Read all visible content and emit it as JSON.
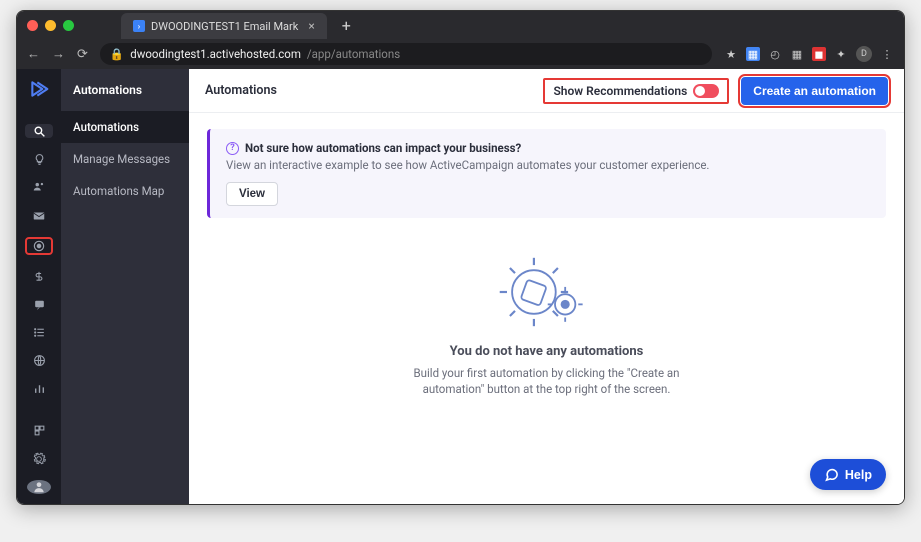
{
  "browser": {
    "tab_title": "DWOODINGTEST1 Email Mark",
    "url_domain": "dwoodingtest1.activehosted.com",
    "url_path": "/app/automations"
  },
  "sidebar": {
    "title": "Automations",
    "items": [
      {
        "label": "Automations",
        "active": true
      },
      {
        "label": "Manage Messages",
        "active": false
      },
      {
        "label": "Automations Map",
        "active": false
      }
    ]
  },
  "header": {
    "title": "Automations",
    "show_recommendations": "Show Recommendations",
    "create_button": "Create an automation"
  },
  "banner": {
    "title": "Not sure how automations can impact your business?",
    "desc": "View an interactive example to see how ActiveCampaign automates your customer experience.",
    "button": "View"
  },
  "empty": {
    "title": "You do not have any automations",
    "desc": "Build your first automation by clicking the \"Create an automation\" button at the top right of the screen."
  },
  "help": {
    "label": "Help"
  },
  "rail": {
    "avatar_initial": "D"
  }
}
